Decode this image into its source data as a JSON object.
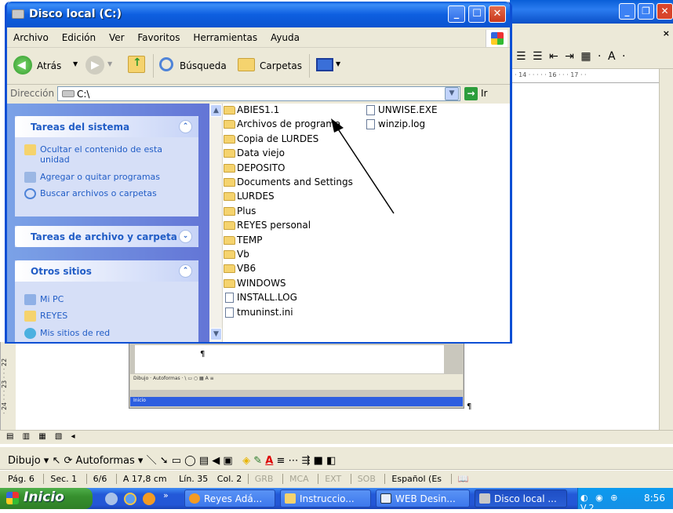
{
  "explorer": {
    "title": "Disco local (C:)",
    "menu": [
      "Archivo",
      "Edición",
      "Ver",
      "Favoritos",
      "Herramientas",
      "Ayuda"
    ],
    "toolbar": {
      "back": "Atrás",
      "search": "Búsqueda",
      "folders": "Carpetas"
    },
    "address": {
      "label": "Dirección",
      "value": "C:\\",
      "go": "Ir"
    },
    "panels": [
      {
        "title": "Tareas del sistema",
        "items": [
          "Ocultar el contenido de esta unidad",
          "Agregar o quitar programas",
          "Buscar archivos o carpetas"
        ]
      },
      {
        "title": "Tareas de archivo y carpeta",
        "items": []
      },
      {
        "title": "Otros sitios",
        "items": [
          "Mi PC",
          "REYES",
          "Mis sitios de red"
        ]
      }
    ],
    "files_col1": [
      "ABIES1.1",
      "Archivos de programa",
      "Copia de LURDES",
      "Data viejo",
      "DEPOSITO",
      "Documents and Settings",
      "LURDES",
      "Plus",
      "REYES personal",
      "TEMP",
      "Vb",
      "VB6",
      "WINDOWS",
      "INSTALL.LOG",
      "tmuninst.ini"
    ],
    "files_col2": [
      "UNWISE.EXE",
      "winzip.log"
    ]
  },
  "word": {
    "ruler_text": "· 14 · · · · · 16 · · · 17 · ·",
    "left_ruler": "· 24 · · · 23 · · · 22",
    "drawing": {
      "dibujo": "Dibujo ▾",
      "autoformas": "Autoformas ▾"
    },
    "status": {
      "page": "Pág. 6",
      "section": "Sec. 1",
      "pages": "6/6",
      "at": "A 17,8 cm",
      "line": "Lín. 35",
      "col": "Col. 2",
      "grb": "GRB",
      "mca": "MCA",
      "ext": "EXT",
      "sob": "SOB",
      "lang": "Español (Es"
    }
  },
  "taskbar": {
    "start": "Inicio",
    "tasks": [
      "Reyes Adá...",
      "Instruccio...",
      "WEB Desin...",
      "Disco local ..."
    ],
    "clock": "8:56"
  }
}
